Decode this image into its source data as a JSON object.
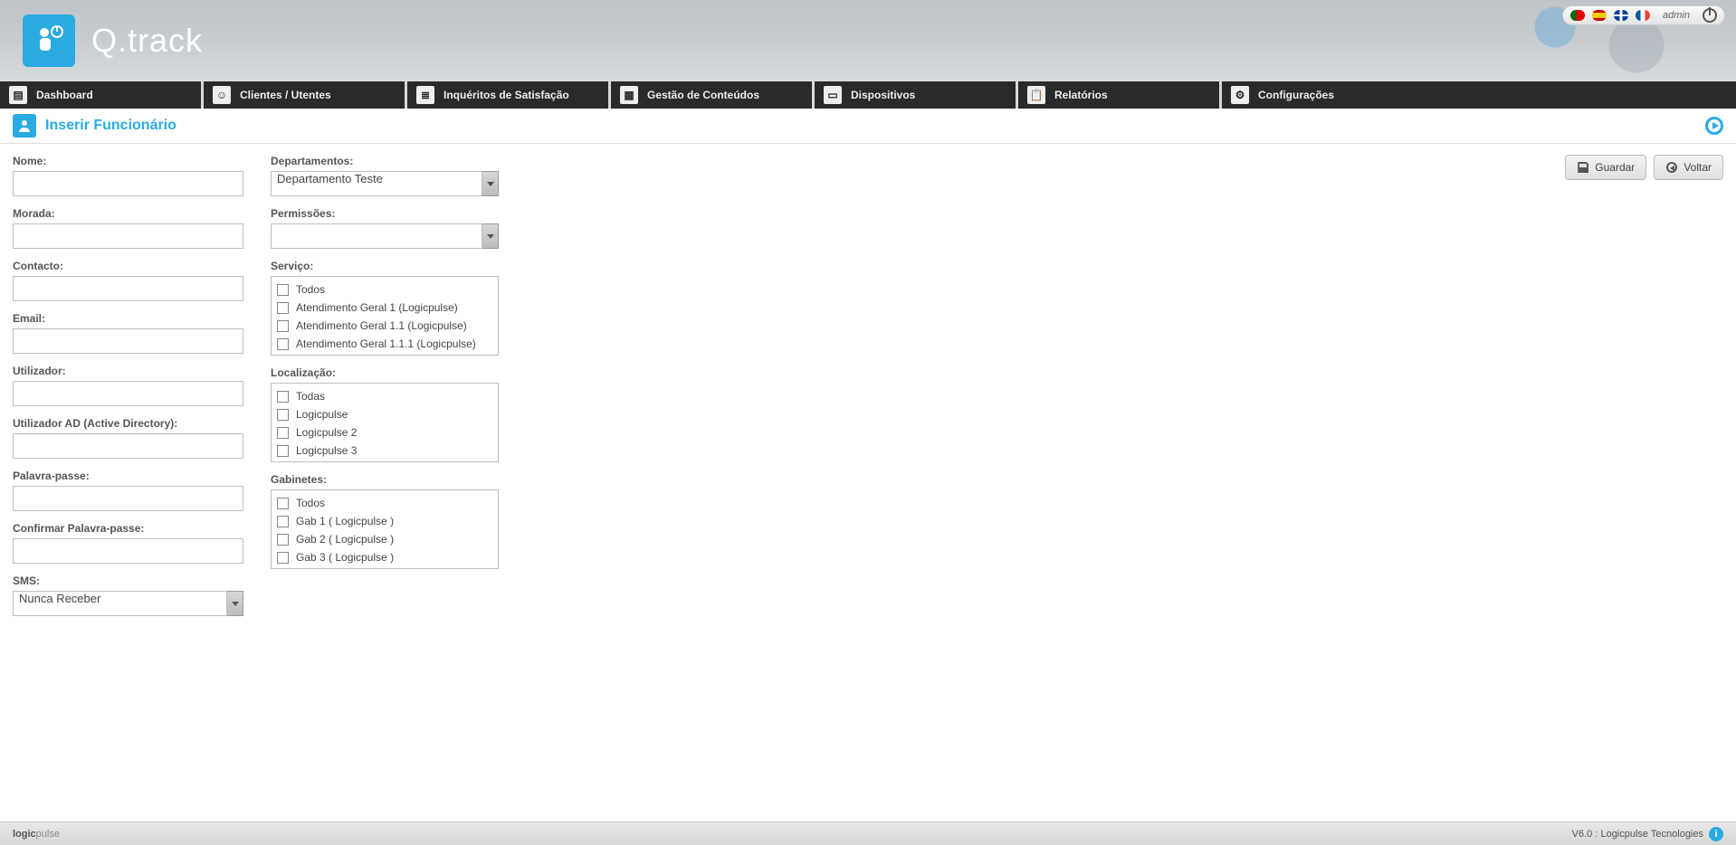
{
  "app": {
    "title": "Q.track"
  },
  "user": {
    "name": "admin"
  },
  "nav": [
    {
      "label": "Dashboard"
    },
    {
      "label": "Clientes / Utentes"
    },
    {
      "label": "Inquéritos de Satisfação"
    },
    {
      "label": "Gestão de Conteúdos"
    },
    {
      "label": "Dispositivos"
    },
    {
      "label": "Relatórios"
    },
    {
      "label": "Configurações"
    }
  ],
  "page": {
    "title": "Inserir Funcionário"
  },
  "buttons": {
    "save": "Guardar",
    "back": "Voltar"
  },
  "left": {
    "nome": "Nome:",
    "morada": "Morada:",
    "contacto": "Contacto:",
    "email": "Email:",
    "utilizador": "Utilizador:",
    "utilizador_ad": "Utilizador AD (Active Directory):",
    "password": "Palavra-passe:",
    "password2": "Confirmar Palavra-passe:",
    "sms": "SMS:",
    "sms_value": "Nunca Receber"
  },
  "mid": {
    "departamentos": "Departamentos:",
    "departamentos_value": "Departamento Teste",
    "permissoes": "Permissões:",
    "permissoes_value": "",
    "servico": "Serviço:",
    "servico_items": [
      "Todos",
      "Atendimento Geral 1 (Logicpulse)",
      "Atendimento Geral 1.1 (Logicpulse)",
      "Atendimento Geral 1.1.1 (Logicpulse)"
    ],
    "localizacao": "Localização:",
    "localizacao_items": [
      "Todas",
      "Logicpulse",
      "Logicpulse 2",
      "Logicpulse 3"
    ],
    "gabinetes": "Gabinetes:",
    "gabinetes_items": [
      "Todos",
      "Gab 1 ( Logicpulse )",
      "Gab 2 ( Logicpulse )",
      "Gab 3 ( Logicpulse )"
    ]
  },
  "footer": {
    "brand": "logicpulse",
    "version": "V6.0 : Logicpulse Tecnologies"
  }
}
